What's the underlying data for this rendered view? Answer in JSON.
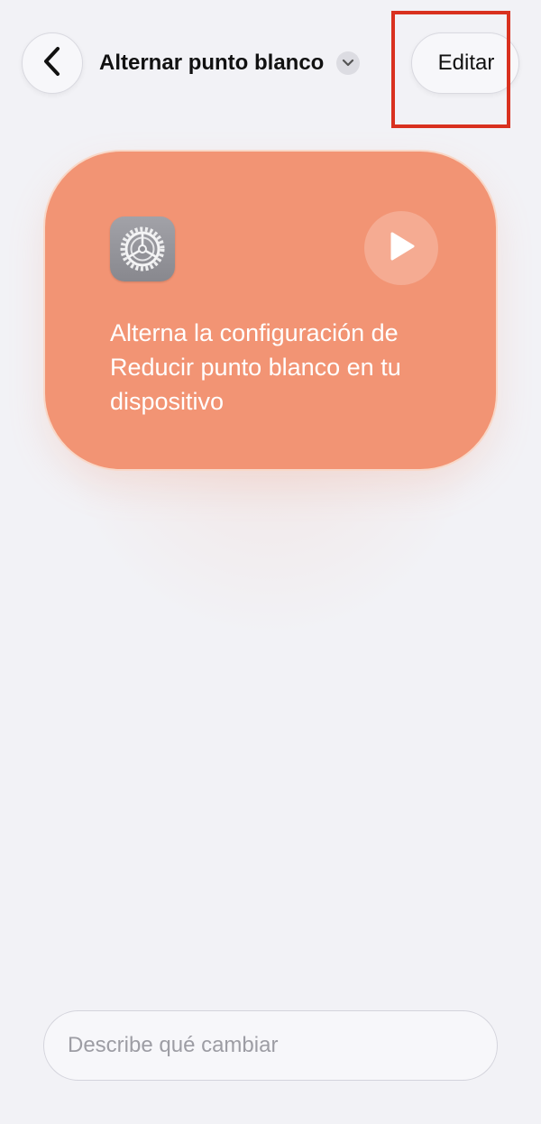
{
  "header": {
    "title": "Alternar punto blanco",
    "back_icon": "chevron-left-icon",
    "title_menu_icon": "chevron-down-icon",
    "edit_label": "Editar",
    "highlight_color": "#d9311f"
  },
  "card": {
    "color": "#f29474",
    "icon": "settings-gear-icon",
    "play_icon": "play-icon",
    "description": "Alterna la configuración de Reducir punto blanco en tu dispositivo"
  },
  "input": {
    "placeholder": "Describe qué cambiar",
    "value": ""
  }
}
